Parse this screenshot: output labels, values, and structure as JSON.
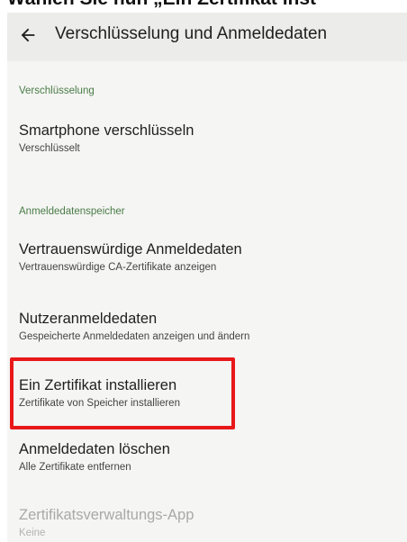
{
  "caption": "Wählen Sie nun „Ein Zertifikat inst",
  "appbar": {
    "back_icon": "arrow-back-icon",
    "title": "Verschlüsselung und Anmeldedaten"
  },
  "sections": [
    {
      "header": "Verschlüsselung",
      "items": [
        {
          "title": "Smartphone verschlüsseln",
          "subtitle": "Verschlüsselt"
        }
      ]
    },
    {
      "header": "Anmeldedatenspeicher",
      "items": [
        {
          "title": "Vertrauenswürdige Anmeldedaten",
          "subtitle": "Vertrauenswürdige CA-Zertifikate anzeigen"
        },
        {
          "title": "Nutzeranmeldedaten",
          "subtitle": "Gespeicherte Anmeldedaten anzeigen und ändern"
        },
        {
          "title": "Ein Zertifikat installieren",
          "subtitle": "Zertifikate von Speicher installieren",
          "highlighted": true
        },
        {
          "title": "Anmeldedaten löschen",
          "subtitle": "Alle Zertifikate entfernen"
        },
        {
          "title": "Zertifikatsverwaltungs-App",
          "subtitle": "Keine",
          "disabled": true
        }
      ]
    }
  ],
  "colors": {
    "accent_green": "#4a7c48",
    "highlight_red": "#e8181a",
    "screen_background": "#f5f5f3"
  }
}
